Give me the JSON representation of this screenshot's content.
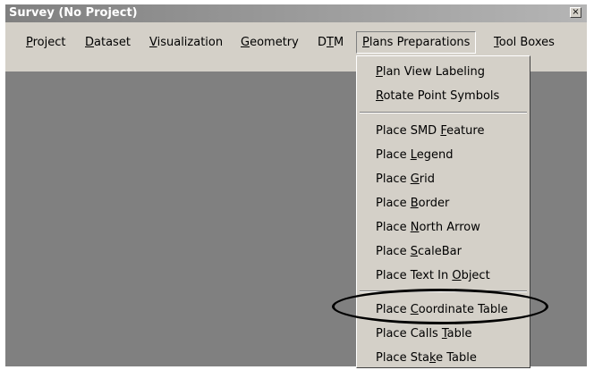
{
  "window": {
    "title": "Survey (No Project)",
    "close_glyph": "×"
  },
  "menubar": [
    {
      "key": "project",
      "label": "Project",
      "accel": "P",
      "rest": "roject"
    },
    {
      "key": "dataset",
      "label": "Dataset",
      "accel": "D",
      "rest": "ataset"
    },
    {
      "key": "visualization",
      "label": "Visualization",
      "accel": "V",
      "rest": "isualization"
    },
    {
      "key": "geometry",
      "label": "Geometry",
      "accel": "G",
      "rest": "eometry"
    },
    {
      "key": "dtm",
      "label": "DTM",
      "pre": "D",
      "accel": "T",
      "rest": "M"
    },
    {
      "key": "plans-preparations",
      "label": "Plans Preparations",
      "accel": "P",
      "rest": "lans Preparations",
      "open": true
    },
    {
      "key": "tool-boxes",
      "label": "Tool Boxes",
      "accel": "T",
      "rest": "ool Boxes"
    }
  ],
  "plans_menu": {
    "items": [
      {
        "label": "Plan View Labeling",
        "pre": "",
        "accel": "P",
        "rest": "lan View Labeling"
      },
      {
        "label": "Rotate Point Symbols",
        "pre": "",
        "accel": "R",
        "rest": "otate Point Symbols"
      },
      {
        "label": "Place SMD Feature",
        "pre": "Place SMD ",
        "accel": "F",
        "rest": "eature"
      },
      {
        "label": "Place Legend",
        "pre": "Place ",
        "accel": "L",
        "rest": "egend"
      },
      {
        "label": "Place Grid",
        "pre": "Place ",
        "accel": "G",
        "rest": "rid"
      },
      {
        "label": "Place Border",
        "pre": "Place ",
        "accel": "B",
        "rest": "order"
      },
      {
        "label": "Place North Arrow",
        "pre": "Place ",
        "accel": "N",
        "rest": "orth Arrow"
      },
      {
        "label": "Place ScaleBar",
        "pre": "Place ",
        "accel": "S",
        "rest": "caleBar"
      },
      {
        "label": "Place Text In Object",
        "pre": "Place Text In ",
        "accel": "O",
        "rest": "bject"
      },
      {
        "label": "Place Coordinate Table",
        "pre": "Place ",
        "accel": "C",
        "rest": "oordinate Table",
        "circled": true
      },
      {
        "label": "Place Calls Table",
        "pre": "Place Calls ",
        "accel": "T",
        "rest": "able"
      },
      {
        "label": "Place Stake Table",
        "pre": "Place Sta",
        "accel": "k",
        "rest": "e Table"
      }
    ]
  },
  "colors": {
    "face": "#d4d0c8",
    "workspace": "#808080",
    "title_text": "#ffffff",
    "highlight_ring": "#000000"
  }
}
